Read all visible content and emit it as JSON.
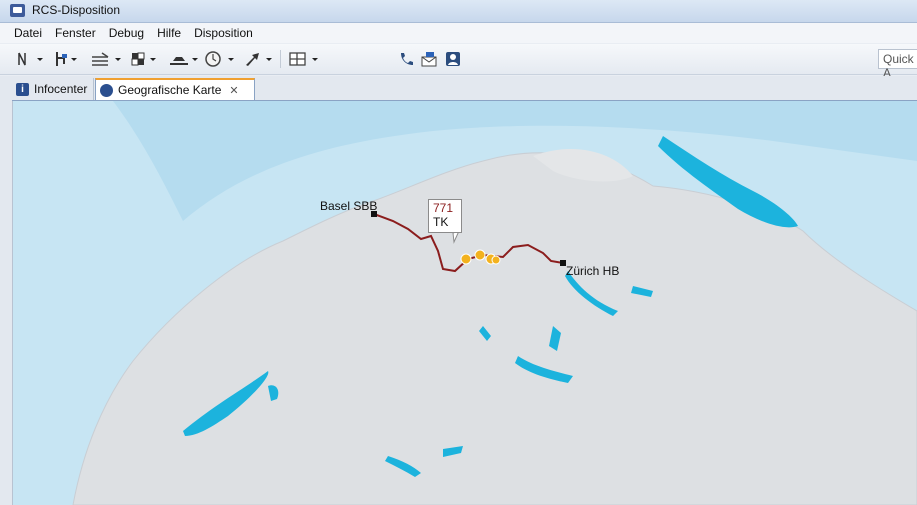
{
  "window": {
    "title": "RCS-Disposition"
  },
  "menu": {
    "items": [
      "Datei",
      "Fenster",
      "Debug",
      "Hilfe",
      "Disposition"
    ]
  },
  "toolbar": {
    "quick_access": "Quick A"
  },
  "tabs": {
    "infocenter": "Infocenter",
    "map": "Geografische Karte"
  },
  "map": {
    "stations": {
      "basel": "Basel SBB",
      "zurich": "Zürich HB"
    },
    "train": {
      "number": "771",
      "code": "TK"
    },
    "colors": {
      "route": "#8b1d1d",
      "water": "#1cb3dd",
      "land": "#dde0e3",
      "train": "#f3b21e"
    }
  }
}
